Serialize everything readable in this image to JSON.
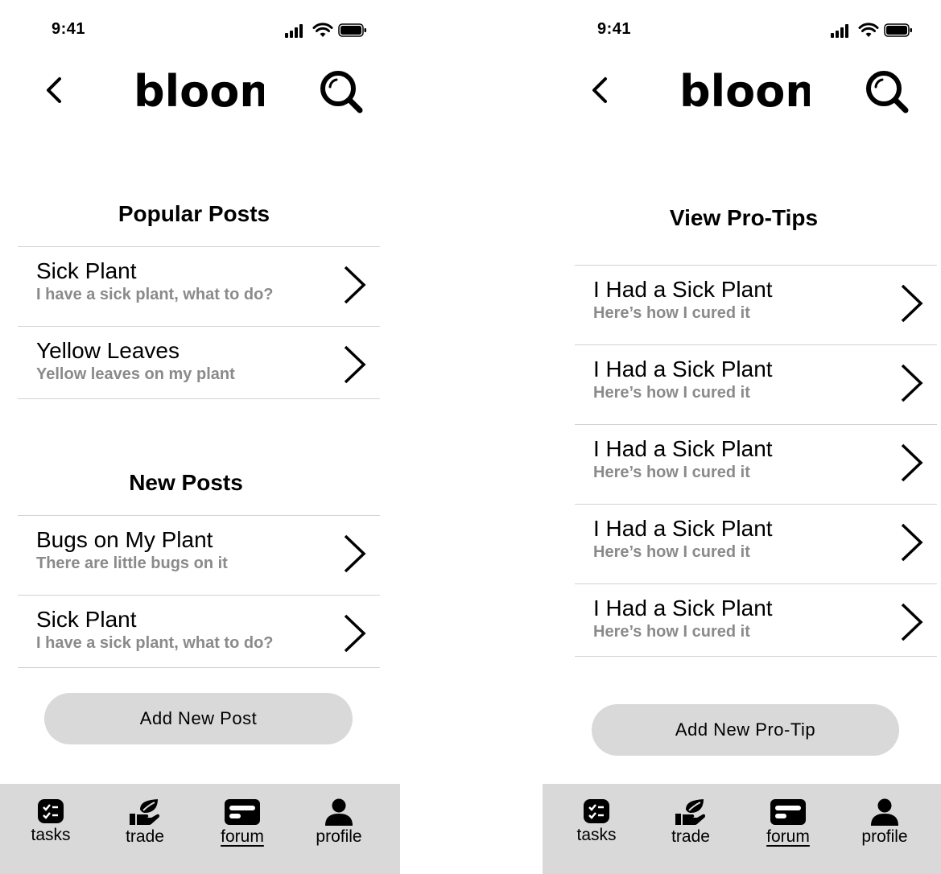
{
  "status_bar": {
    "time": "9:41"
  },
  "brand": {
    "logo_text": "bloom"
  },
  "left_screen": {
    "sections": [
      {
        "title": "Popular Posts",
        "items": [
          {
            "title": "Sick Plant",
            "subtitle": "I have a sick plant, what to do?"
          },
          {
            "title": "Yellow Leaves",
            "subtitle": "Yellow leaves on my plant"
          }
        ]
      },
      {
        "title": "New Posts",
        "items": [
          {
            "title": "Bugs on My Plant",
            "subtitle": "There are little bugs on it"
          },
          {
            "title": "Sick Plant",
            "subtitle": "I have a sick plant, what to do?"
          }
        ]
      }
    ],
    "add_button": "Add New Post"
  },
  "right_screen": {
    "title": "View Pro-Tips",
    "items": [
      {
        "title": "I Had a Sick Plant",
        "subtitle": "Here’s how I cured it"
      },
      {
        "title": "I Had a Sick Plant",
        "subtitle": "Here’s how I cured it"
      },
      {
        "title": "I Had a Sick Plant",
        "subtitle": "Here’s how I cured it"
      },
      {
        "title": "I Had a Sick Plant",
        "subtitle": "Here’s how I cured it"
      },
      {
        "title": "I Had a Sick Plant",
        "subtitle": "Here’s how I cured it"
      }
    ],
    "add_button": "Add New Pro-Tip"
  },
  "tabbar": {
    "active": "forum",
    "tabs": [
      {
        "id": "tasks",
        "label": "tasks",
        "icon": "checklist-icon"
      },
      {
        "id": "trade",
        "label": "trade",
        "icon": "hand-leaf-icon"
      },
      {
        "id": "forum",
        "label": "forum",
        "icon": "card-icon"
      },
      {
        "id": "profile",
        "label": "profile",
        "icon": "person-icon"
      }
    ]
  },
  "colors": {
    "tabbar_bg": "#d9d9d9",
    "button_bg": "#d9d9d9",
    "subtitle": "#8a8a8a",
    "divider": "#d2d2d2"
  }
}
